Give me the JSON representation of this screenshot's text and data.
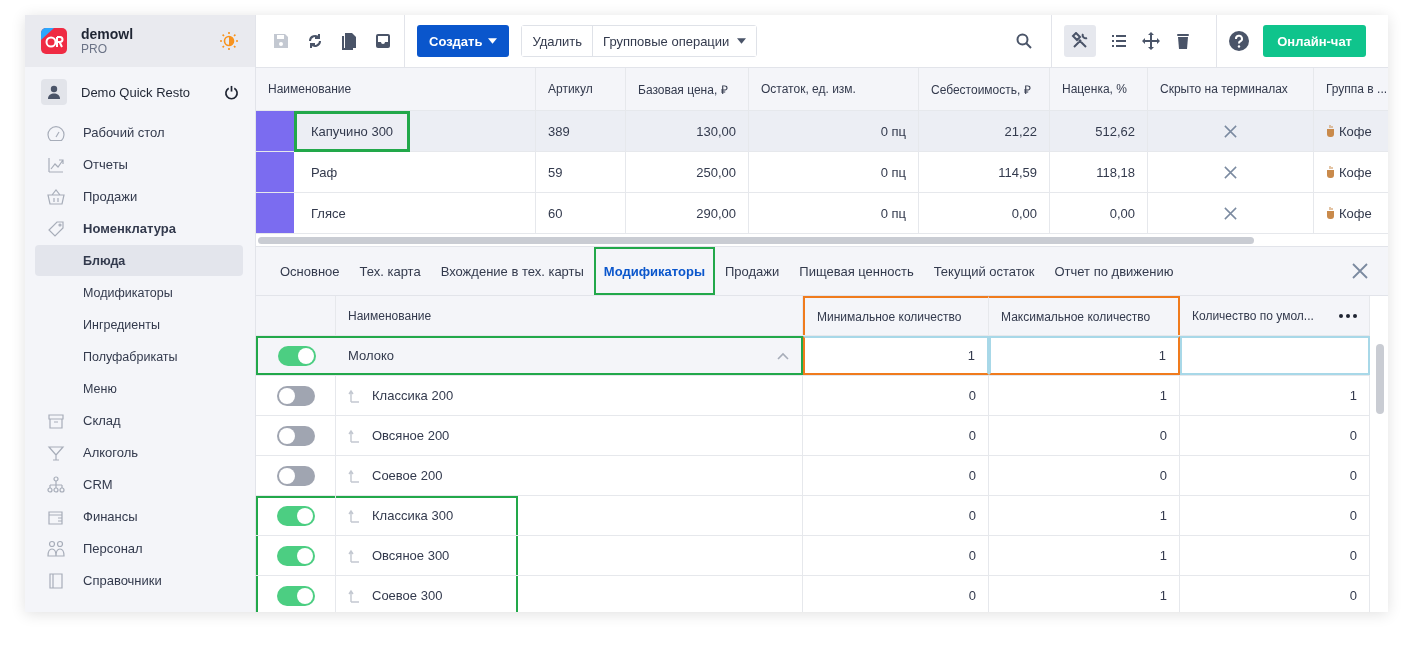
{
  "account": {
    "name": "demowl",
    "plan": "PRO"
  },
  "user": {
    "name": "Demo Quick Resto"
  },
  "sidebar": {
    "items": [
      {
        "label": "Рабочий стол",
        "selected": false
      },
      {
        "label": "Отчеты",
        "selected": false
      },
      {
        "label": "Продажи",
        "selected": false
      },
      {
        "label": "Номенклатура",
        "selected": false,
        "expanded": true,
        "children": [
          {
            "label": "Блюда",
            "selected": true
          },
          {
            "label": "Модификаторы",
            "selected": false
          },
          {
            "label": "Ингредиенты",
            "selected": false
          },
          {
            "label": "Полуфабрикаты",
            "selected": false
          },
          {
            "label": "Меню",
            "selected": false
          }
        ]
      },
      {
        "label": "Склад",
        "selected": false
      },
      {
        "label": "Алкоголь",
        "selected": false
      },
      {
        "label": "CRM",
        "selected": false
      },
      {
        "label": "Финансы",
        "selected": false
      },
      {
        "label": "Персонал",
        "selected": false
      },
      {
        "label": "Справочники",
        "selected": false
      }
    ]
  },
  "toolbar": {
    "create_button": "Создать",
    "delete_button": "Удалить",
    "group_button": "Групповые операции",
    "chat_button": "Онлайн-чат",
    "save_disabled": true,
    "tools_active": true
  },
  "products": {
    "columns": [
      "Наименование",
      "Артикул",
      "Базовая цена, ₽",
      "Остаток, ед. изм.",
      "Себестоимость, ₽",
      "Наценка, %",
      "Скрыто на терминалах",
      "Группа в ..."
    ],
    "rows": [
      {
        "name": "Капучино 300",
        "sku": "389",
        "price": "130,00",
        "stock": "0 пц",
        "cost": "21,22",
        "markup": "512,62",
        "hidden": false,
        "group": "Кофе",
        "selected": true,
        "highlighted": true,
        "color": "#7b6cf0"
      },
      {
        "name": "Раф",
        "sku": "59",
        "price": "250,00",
        "stock": "0 пц",
        "cost": "114,59",
        "markup": "118,18",
        "hidden": false,
        "group": "Кофе",
        "selected": false,
        "highlighted": false,
        "color": "#7b6cf0"
      },
      {
        "name": "Глясе",
        "sku": "60",
        "price": "290,00",
        "stock": "0 пц",
        "cost": "0,00",
        "markup": "0,00",
        "hidden": false,
        "group": "Кофе",
        "selected": false,
        "highlighted": false,
        "color": "#7b6cf0"
      }
    ]
  },
  "detail_tabs": [
    {
      "label": "Основное",
      "selected": false,
      "highlighted": false
    },
    {
      "label": "Тех. карта",
      "selected": false,
      "highlighted": false
    },
    {
      "label": "Вхождение в тех. карты",
      "selected": false,
      "highlighted": false
    },
    {
      "label": "Модификаторы",
      "selected": true,
      "highlighted": true
    },
    {
      "label": "Продажи",
      "selected": false,
      "highlighted": false
    },
    {
      "label": "Пищевая ценность",
      "selected": false,
      "highlighted": false
    },
    {
      "label": "Текущий остаток",
      "selected": false,
      "highlighted": false
    },
    {
      "label": "Отчет по движению",
      "selected": false,
      "highlighted": false
    }
  ],
  "modifiers": {
    "columns": [
      {
        "label": "Наименование",
        "highlighted": false
      },
      {
        "label": "Минимальное количество",
        "highlighted": true
      },
      {
        "label": "Максимальное количество",
        "highlighted": true
      },
      {
        "label": "Количество по умол...",
        "highlighted": false
      }
    ],
    "rows": [
      {
        "name": "Молоко",
        "on": true,
        "expanded": true,
        "min": "1",
        "max": "1",
        "highlighted": true,
        "children": [
          {
            "name": "Классика 200",
            "on": false,
            "min": "0",
            "max": "1",
            "default": "1",
            "highlighted": false
          },
          {
            "name": "Овсяное 200",
            "on": false,
            "min": "0",
            "max": "0",
            "default": "0",
            "highlighted": false
          },
          {
            "name": "Соевое 200",
            "on": false,
            "min": "0",
            "max": "0",
            "default": "0",
            "highlighted": false
          },
          {
            "name": "Классика 300",
            "on": true,
            "min": "0",
            "max": "1",
            "default": "0",
            "highlighted": true
          },
          {
            "name": "Овсяное 300",
            "on": true,
            "min": "0",
            "max": "1",
            "default": "0",
            "highlighted": true
          },
          {
            "name": "Соевое 300",
            "on": true,
            "min": "0",
            "max": "1",
            "default": "0",
            "highlighted": true
          }
        ]
      }
    ]
  }
}
